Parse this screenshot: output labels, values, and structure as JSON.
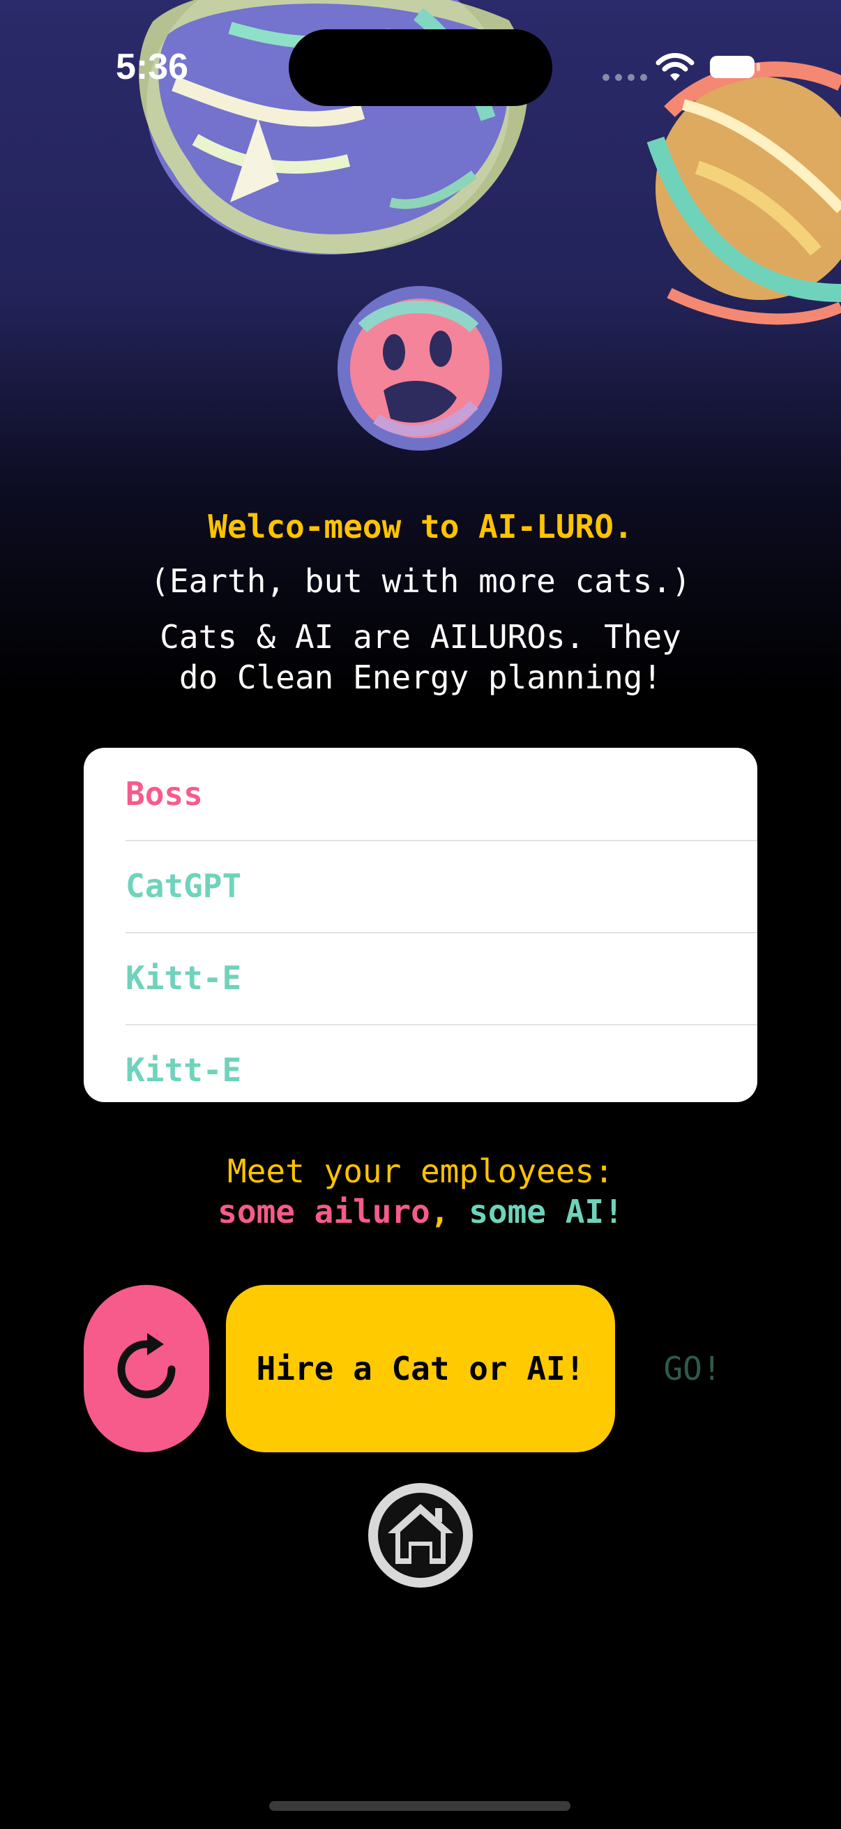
{
  "status_bar": {
    "time": "5:36"
  },
  "intro": {
    "title": "Welco-meow to AI-LURO.",
    "subtitle": "(Earth, but with more cats.)",
    "description_line1": "Cats & AI are AILUROs. They",
    "description_line2": "do Clean Energy planning!"
  },
  "employees": [
    {
      "name": "Boss",
      "kind": "ailuro"
    },
    {
      "name": "CatGPT",
      "kind": "ai"
    },
    {
      "name": "Kitt-E",
      "kind": "ai"
    },
    {
      "name": "Kitt-E",
      "kind": "ai"
    }
  ],
  "meet": {
    "line1": "Meet your employees:",
    "part_ailuro": "some ailuro",
    "separator": ", ",
    "part_ai": "some AI",
    "exclaim": "!"
  },
  "actions": {
    "refresh_icon": "refresh-icon",
    "hire_label": "Hire a Cat or AI!",
    "go_label": "GO!",
    "home_icon": "home-icon"
  },
  "colors": {
    "accent_yellow": "#ffc300",
    "ailuro_pink": "#f65b8b",
    "ai_teal": "#6fd3bb",
    "go_dim": "#2f5a4c"
  }
}
